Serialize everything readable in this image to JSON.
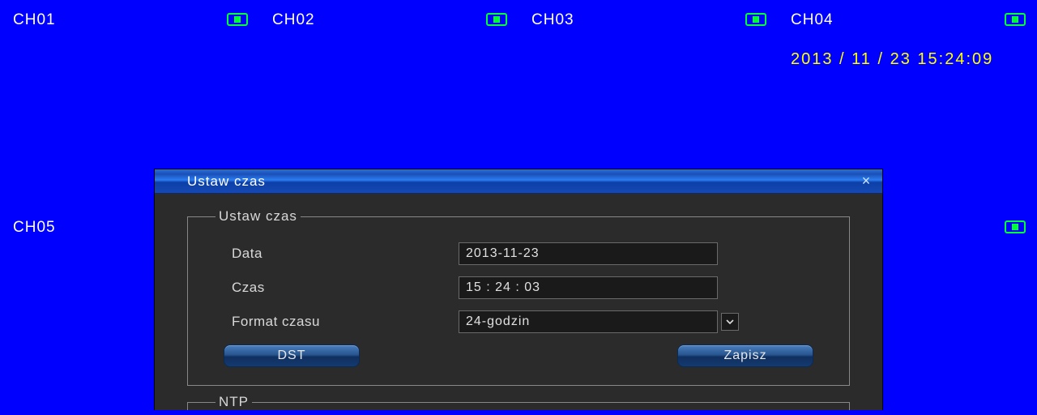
{
  "channels": {
    "ch01": "CH01",
    "ch02": "CH02",
    "ch03": "CH03",
    "ch04": "CH04",
    "ch05": "CH05"
  },
  "clock": "2013 / 11 / 23  15:24:09",
  "dialog": {
    "title": "Ustaw  czas",
    "group1_legend": "Ustaw  czas",
    "date_label": "Data",
    "date_value": "2013-11-23",
    "time_label": "Czas",
    "time_value": "15 : 24 : 03",
    "format_label": "Format  czasu",
    "format_value": "24-godzin",
    "dst_btn": "DST",
    "save_btn": "Zapisz",
    "group2_legend": "NTP"
  }
}
